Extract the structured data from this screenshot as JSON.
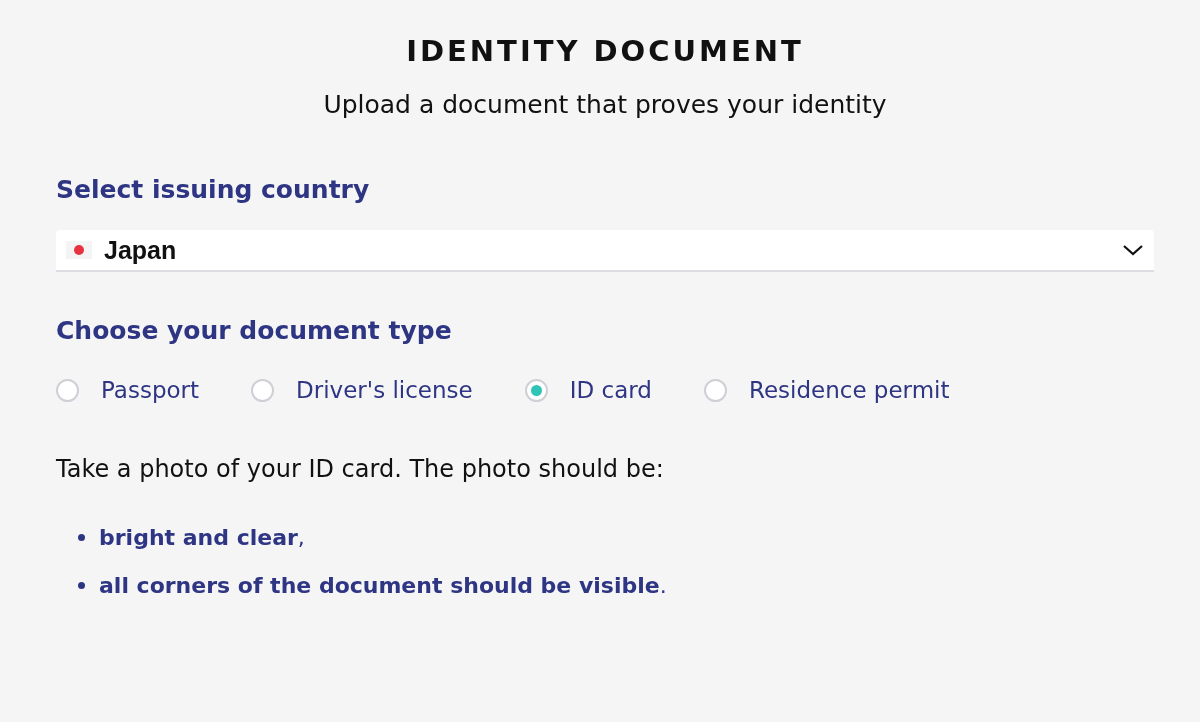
{
  "title": "IDENTITY DOCUMENT",
  "subtitle": "Upload a document that proves your identity",
  "country": {
    "label": "Select issuing country",
    "value": "Japan"
  },
  "document_type": {
    "label": "Choose your document type",
    "options": [
      {
        "label": "Passport",
        "selected": false
      },
      {
        "label": "Driver's license",
        "selected": false
      },
      {
        "label": "ID card",
        "selected": true
      },
      {
        "label": "Residence permit",
        "selected": false
      }
    ]
  },
  "instructions": "Take a photo of your ID card. The photo should be:",
  "requirements": [
    "**bright and clear**,",
    "**all corners of the document should be visible**."
  ]
}
